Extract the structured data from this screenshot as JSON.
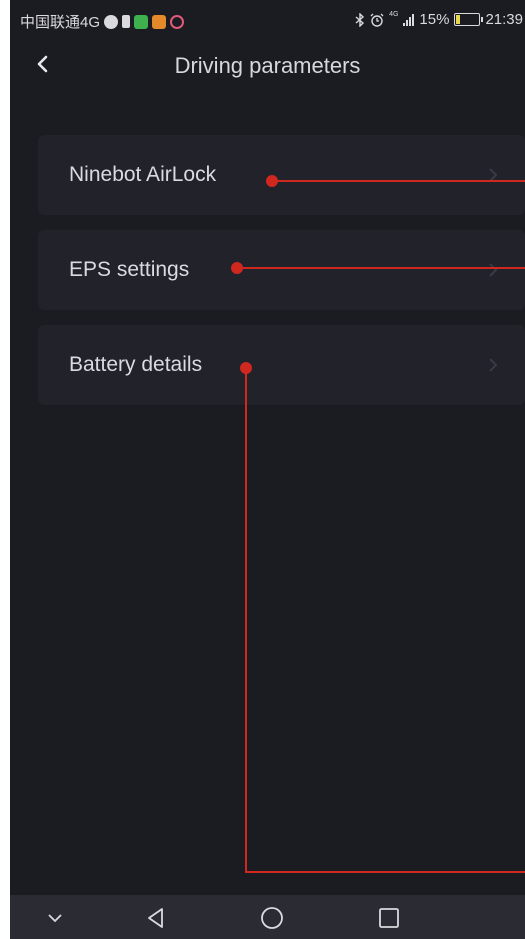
{
  "status_bar": {
    "carrier": "中国联通4G",
    "battery_percent": "15%",
    "battery_level": 0.15,
    "time": "21:39",
    "network_badge": "4G",
    "icons": [
      "notification-icon",
      "battery-small-icon",
      "app-green-icon",
      "app-orange-icon",
      "app-ring-icon",
      "bluetooth-icon",
      "alarm-icon",
      "signal-icon",
      "battery-icon"
    ]
  },
  "header": {
    "title": "Driving parameters",
    "back_icon": "back-arrow-icon"
  },
  "menu": {
    "items": [
      {
        "label": "Ninebot AirLock",
        "icon": "chevron-right-icon"
      },
      {
        "label": "EPS settings",
        "icon": "chevron-right-icon"
      },
      {
        "label": "Battery details",
        "icon": "chevron-right-icon"
      }
    ]
  },
  "annotation": {
    "color": "#d0271f"
  },
  "nav_bar": {
    "buttons": [
      "collapse-icon",
      "back-triangle-icon",
      "home-circle-icon",
      "recents-square-icon"
    ]
  }
}
